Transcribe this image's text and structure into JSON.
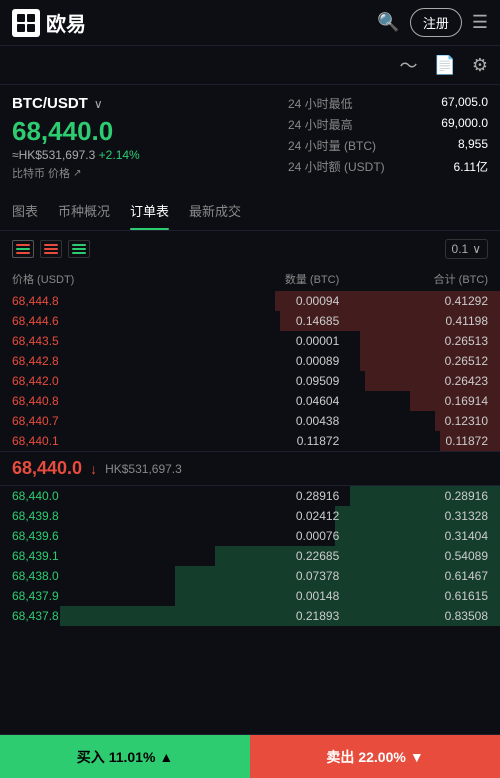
{
  "header": {
    "logo_text": "欧易",
    "register_label": "注册",
    "menu_icon": "☰"
  },
  "pair": {
    "name": "BTC/USDT",
    "main_price": "68,440.0",
    "hk_price": "≈HK$531,697.3",
    "change_pct": "+2.14%",
    "coin_label": "比特币 价格",
    "stats": [
      {
        "label": "24 小时最低",
        "value": "67,005.0"
      },
      {
        "label": "24 小时最高",
        "value": "69,000.0"
      },
      {
        "label": "24 小时量 (BTC)",
        "value": "8,955"
      },
      {
        "label": "24 小时额 (USDT)",
        "value": "6.11亿"
      }
    ]
  },
  "tabs": [
    {
      "label": "图表",
      "active": false
    },
    {
      "label": "币种概况",
      "active": false
    },
    {
      "label": "订单表",
      "active": true
    },
    {
      "label": "最新成交",
      "active": false
    }
  ],
  "orderbook": {
    "precision": "0.1",
    "col_headers": {
      "price": "价格 (USDT)",
      "amount": "数量 (BTC)",
      "total": "合计 (BTC)"
    },
    "sells": [
      {
        "price": "68,444.8",
        "amount": "0.00094",
        "total": "0.41292",
        "bar_pct": 45
      },
      {
        "price": "68,444.6",
        "amount": "0.14685",
        "total": "0.41198",
        "bar_pct": 44
      },
      {
        "price": "68,443.5",
        "amount": "0.00001",
        "total": "0.26513",
        "bar_pct": 28
      },
      {
        "price": "68,442.8",
        "amount": "0.00089",
        "total": "0.26512",
        "bar_pct": 28
      },
      {
        "price": "68,442.0",
        "amount": "0.09509",
        "total": "0.26423",
        "bar_pct": 27
      },
      {
        "price": "68,440.8",
        "amount": "0.04604",
        "total": "0.16914",
        "bar_pct": 18
      },
      {
        "price": "68,440.7",
        "amount": "0.00438",
        "total": "0.12310",
        "bar_pct": 13
      },
      {
        "price": "68,440.1",
        "amount": "0.11872",
        "total": "0.11872",
        "bar_pct": 12
      }
    ],
    "mid_price": "68,440.0",
    "mid_hk": "HK$531,697.3",
    "buys": [
      {
        "price": "68,440.0",
        "amount": "0.28916",
        "total": "0.28916",
        "bar_pct": 30
      },
      {
        "price": "68,439.8",
        "amount": "0.02412",
        "total": "0.31328",
        "bar_pct": 33
      },
      {
        "price": "68,439.6",
        "amount": "0.00076",
        "total": "0.31404",
        "bar_pct": 33
      },
      {
        "price": "68,439.1",
        "amount": "0.22685",
        "total": "0.54089",
        "bar_pct": 57
      },
      {
        "price": "68,438.0",
        "amount": "0.07378",
        "total": "0.61467",
        "bar_pct": 65
      },
      {
        "price": "68,437.9",
        "amount": "0.00148",
        "total": "0.61615",
        "bar_pct": 65
      },
      {
        "price": "68,437.8",
        "amount": "0.21893",
        "total": "0.83508",
        "bar_pct": 88
      }
    ]
  },
  "bottom": {
    "buy_label": "买入",
    "buy_pct": "11.01%",
    "sell_label": "卖出",
    "sell_pct": "22.00%"
  }
}
